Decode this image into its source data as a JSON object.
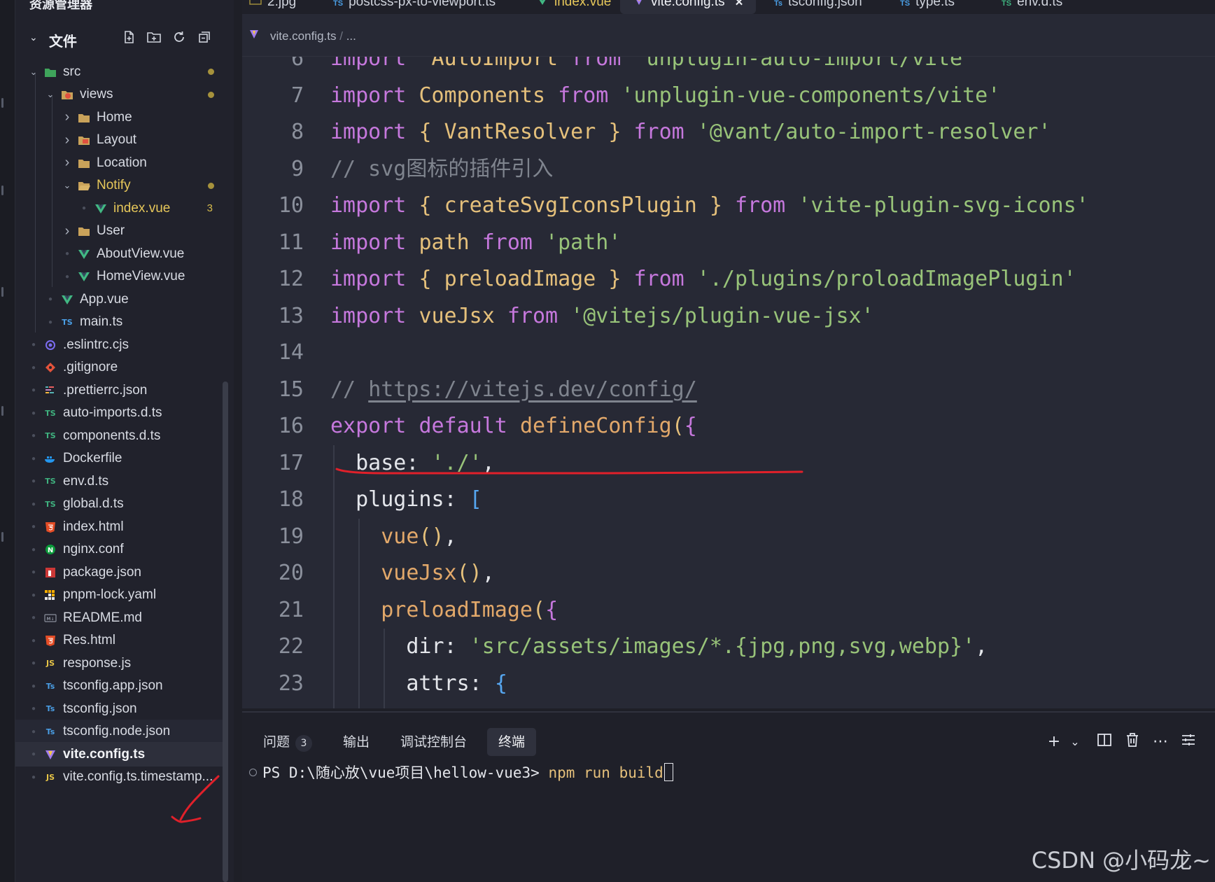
{
  "sidebar": {
    "title": "资源管理器",
    "section": "文件",
    "items": [
      {
        "name": "src",
        "kind": "folder",
        "icon": "src-folder-icon",
        "depth": 0,
        "expanded": true,
        "modified": true
      },
      {
        "name": "views",
        "kind": "folder",
        "icon": "views-folder-icon",
        "depth": 1,
        "expanded": true,
        "modified": true
      },
      {
        "name": "Home",
        "kind": "folder",
        "icon": "folder-icon",
        "depth": 2,
        "expanded": false
      },
      {
        "name": "Layout",
        "kind": "folder",
        "icon": "layout-folder-icon",
        "depth": 2,
        "expanded": false
      },
      {
        "name": "Location",
        "kind": "folder",
        "icon": "folder-icon",
        "depth": 2,
        "expanded": false
      },
      {
        "name": "Notify",
        "kind": "folder",
        "icon": "folder-open-icon",
        "depth": 2,
        "expanded": true,
        "modified": true,
        "highlight": true
      },
      {
        "name": "index.vue",
        "kind": "file",
        "icon": "vue-icon",
        "depth": 3,
        "count": "3",
        "highlight": true
      },
      {
        "name": "User",
        "kind": "folder",
        "icon": "folder-icon",
        "depth": 2,
        "expanded": false
      },
      {
        "name": "AboutView.vue",
        "kind": "file",
        "icon": "vue-icon",
        "depth": 2
      },
      {
        "name": "HomeView.vue",
        "kind": "file",
        "icon": "vue-icon",
        "depth": 2
      },
      {
        "name": "App.vue",
        "kind": "file",
        "icon": "vue-icon",
        "depth": 1
      },
      {
        "name": "main.ts",
        "kind": "file",
        "icon": "ts-icon",
        "depth": 1
      },
      {
        "name": ".eslintrc.cjs",
        "kind": "file",
        "icon": "eslint-icon",
        "depth": 0
      },
      {
        "name": ".gitignore",
        "kind": "file",
        "icon": "git-icon",
        "depth": 0
      },
      {
        "name": ".prettierrc.json",
        "kind": "file",
        "icon": "prettier-icon",
        "depth": 0
      },
      {
        "name": "auto-imports.d.ts",
        "kind": "file",
        "icon": "ts-def-icon",
        "depth": 0
      },
      {
        "name": "components.d.ts",
        "kind": "file",
        "icon": "ts-def-icon",
        "depth": 0
      },
      {
        "name": "Dockerfile",
        "kind": "file",
        "icon": "docker-icon",
        "depth": 0
      },
      {
        "name": "env.d.ts",
        "kind": "file",
        "icon": "ts-def-icon",
        "depth": 0
      },
      {
        "name": "global.d.ts",
        "kind": "file",
        "icon": "ts-def-icon",
        "depth": 0
      },
      {
        "name": "index.html",
        "kind": "file",
        "icon": "html-icon",
        "depth": 0
      },
      {
        "name": "nginx.conf",
        "kind": "file",
        "icon": "nginx-icon",
        "depth": 0
      },
      {
        "name": "package.json",
        "kind": "file",
        "icon": "npm-icon",
        "depth": 0
      },
      {
        "name": "pnpm-lock.yaml",
        "kind": "file",
        "icon": "pnpm-icon",
        "depth": 0
      },
      {
        "name": "README.md",
        "kind": "file",
        "icon": "markdown-icon",
        "depth": 0
      },
      {
        "name": "Res.html",
        "kind": "file",
        "icon": "html-icon",
        "depth": 0
      },
      {
        "name": "response.js",
        "kind": "file",
        "icon": "js-icon",
        "depth": 0
      },
      {
        "name": "tsconfig.app.json",
        "kind": "file",
        "icon": "tsconfig-icon",
        "depth": 0
      },
      {
        "name": "tsconfig.json",
        "kind": "file",
        "icon": "tsconfig-icon",
        "depth": 0
      },
      {
        "name": "tsconfig.node.json",
        "kind": "file",
        "icon": "tsconfig-icon",
        "depth": 0,
        "hover": true
      },
      {
        "name": "vite.config.ts",
        "kind": "file",
        "icon": "vite-icon",
        "depth": 0,
        "active": true
      },
      {
        "name": "vite.config.ts.timestamp...",
        "kind": "file",
        "icon": "js-icon",
        "depth": 0
      }
    ]
  },
  "tabs": [
    {
      "label": "2.jpg",
      "icon": "image-icon"
    },
    {
      "label": "postcss-px-to-viewport.ts",
      "icon": "ts-icon"
    },
    {
      "label": "index.vue",
      "icon": "vue-icon",
      "modified": true
    },
    {
      "label": "vite.config.ts",
      "icon": "vite-icon",
      "active": true
    },
    {
      "label": "tsconfig.json",
      "icon": "tsconfig-icon"
    },
    {
      "label": "type.ts",
      "icon": "ts-icon"
    },
    {
      "label": "env.d.ts",
      "icon": "ts-def-icon"
    }
  ],
  "breadcrumb": {
    "file": "vite.config.ts",
    "sep": "/",
    "rest": "..."
  },
  "code": [
    {
      "n": "6",
      "tokens": [
        [
          "kw",
          "import"
        ],
        [
          "",
          "  "
        ],
        [
          "ty",
          "AutoImport"
        ],
        [
          "",
          " "
        ],
        [
          "kw",
          "from"
        ],
        [
          "",
          " "
        ],
        [
          "st",
          "'unplugin-auto-import/vite'"
        ]
      ]
    },
    {
      "n": "7",
      "tokens": [
        [
          "kw",
          "import"
        ],
        [
          "",
          " "
        ],
        [
          "ty",
          "Components"
        ],
        [
          "",
          " "
        ],
        [
          "kw",
          "from"
        ],
        [
          "",
          " "
        ],
        [
          "st",
          "'unplugin-vue-components/vite'"
        ]
      ]
    },
    {
      "n": "8",
      "tokens": [
        [
          "kw",
          "import"
        ],
        [
          "",
          " "
        ],
        [
          "y",
          "{"
        ],
        [
          "",
          " "
        ],
        [
          "ty",
          "VantResolver"
        ],
        [
          "",
          " "
        ],
        [
          "y",
          "}"
        ],
        [
          "",
          " "
        ],
        [
          "kw",
          "from"
        ],
        [
          "",
          " "
        ],
        [
          "st",
          "'@vant/auto-import-resolver'"
        ]
      ]
    },
    {
      "n": "9",
      "tokens": [
        [
          "cm",
          "// svg图标的插件引入"
        ]
      ]
    },
    {
      "n": "10",
      "tokens": [
        [
          "kw",
          "import"
        ],
        [
          "",
          " "
        ],
        [
          "y",
          "{"
        ],
        [
          "",
          " "
        ],
        [
          "ty",
          "createSvgIconsPlugin"
        ],
        [
          "",
          " "
        ],
        [
          "y",
          "}"
        ],
        [
          "",
          " "
        ],
        [
          "kw",
          "from"
        ],
        [
          "",
          " "
        ],
        [
          "st",
          "'vite-plugin-svg-icons'"
        ]
      ]
    },
    {
      "n": "11",
      "tokens": [
        [
          "kw",
          "import"
        ],
        [
          "",
          " "
        ],
        [
          "ty",
          "path"
        ],
        [
          "",
          " "
        ],
        [
          "kw",
          "from"
        ],
        [
          "",
          " "
        ],
        [
          "st",
          "'path'"
        ]
      ]
    },
    {
      "n": "12",
      "tokens": [
        [
          "kw",
          "import"
        ],
        [
          "",
          " "
        ],
        [
          "y",
          "{"
        ],
        [
          "",
          " "
        ],
        [
          "ty",
          "preloadImage"
        ],
        [
          "",
          " "
        ],
        [
          "y",
          "}"
        ],
        [
          "",
          " "
        ],
        [
          "kw",
          "from"
        ],
        [
          "",
          " "
        ],
        [
          "st",
          "'./plugins/proloadImagePlugin'"
        ]
      ]
    },
    {
      "n": "13",
      "tokens": [
        [
          "kw",
          "import"
        ],
        [
          "",
          " "
        ],
        [
          "ty",
          "vueJsx"
        ],
        [
          "",
          " "
        ],
        [
          "kw",
          "from"
        ],
        [
          "",
          " "
        ],
        [
          "st",
          "'@vitejs/plugin-vue-jsx'"
        ]
      ]
    },
    {
      "n": "14",
      "tokens": []
    },
    {
      "n": "15",
      "tokens": [
        [
          "cm",
          "// "
        ],
        [
          "cm url",
          "https://vitejs.dev/config/"
        ]
      ]
    },
    {
      "n": "16",
      "tokens": [
        [
          "kw",
          "export"
        ],
        [
          "",
          " "
        ],
        [
          "kw",
          "default"
        ],
        [
          "",
          " "
        ],
        [
          "fn",
          "defineConfig"
        ],
        [
          "y",
          "("
        ],
        [
          "mg",
          "{"
        ]
      ]
    },
    {
      "n": "17",
      "tokens": [
        [
          "",
          "  base: "
        ],
        [
          "st",
          "'./'"
        ],
        [
          "",
          ","
        ]
      ]
    },
    {
      "n": "18",
      "tokens": [
        [
          "",
          "  plugins: "
        ],
        [
          "bl",
          "["
        ]
      ]
    },
    {
      "n": "19",
      "tokens": [
        [
          "",
          "    "
        ],
        [
          "fn",
          "vue"
        ],
        [
          "y",
          "()"
        ],
        [
          "",
          ","
        ]
      ]
    },
    {
      "n": "20",
      "tokens": [
        [
          "",
          "    "
        ],
        [
          "fn",
          "vueJsx"
        ],
        [
          "y",
          "()"
        ],
        [
          "",
          ","
        ]
      ]
    },
    {
      "n": "21",
      "tokens": [
        [
          "",
          "    "
        ],
        [
          "fn",
          "preloadImage"
        ],
        [
          "y",
          "("
        ],
        [
          "mg",
          "{"
        ]
      ]
    },
    {
      "n": "22",
      "tokens": [
        [
          "",
          "      dir: "
        ],
        [
          "st",
          "'src/assets/images/*.{jpg,png,svg,webp}'"
        ],
        [
          "",
          ","
        ]
      ]
    },
    {
      "n": "23",
      "tokens": [
        [
          "",
          "      attrs: "
        ],
        [
          "bl",
          "{"
        ]
      ]
    }
  ],
  "panel": {
    "tabs": [
      {
        "label": "问题",
        "badge": "3"
      },
      {
        "label": "输出"
      },
      {
        "label": "调试控制台"
      },
      {
        "label": "终端",
        "active": true
      }
    ],
    "terminal": {
      "prompt": "PS D:\\随心放\\vue项目\\hellow-vue3> ",
      "command": "npm run build"
    }
  },
  "watermark": "CSDN @小码龙~",
  "colors": {
    "keyword": "#c678dd",
    "type": "#e5c07b",
    "string": "#98c379",
    "comment": "#7f848e",
    "function": "#e2a86a",
    "annotation": "#e0202a"
  }
}
